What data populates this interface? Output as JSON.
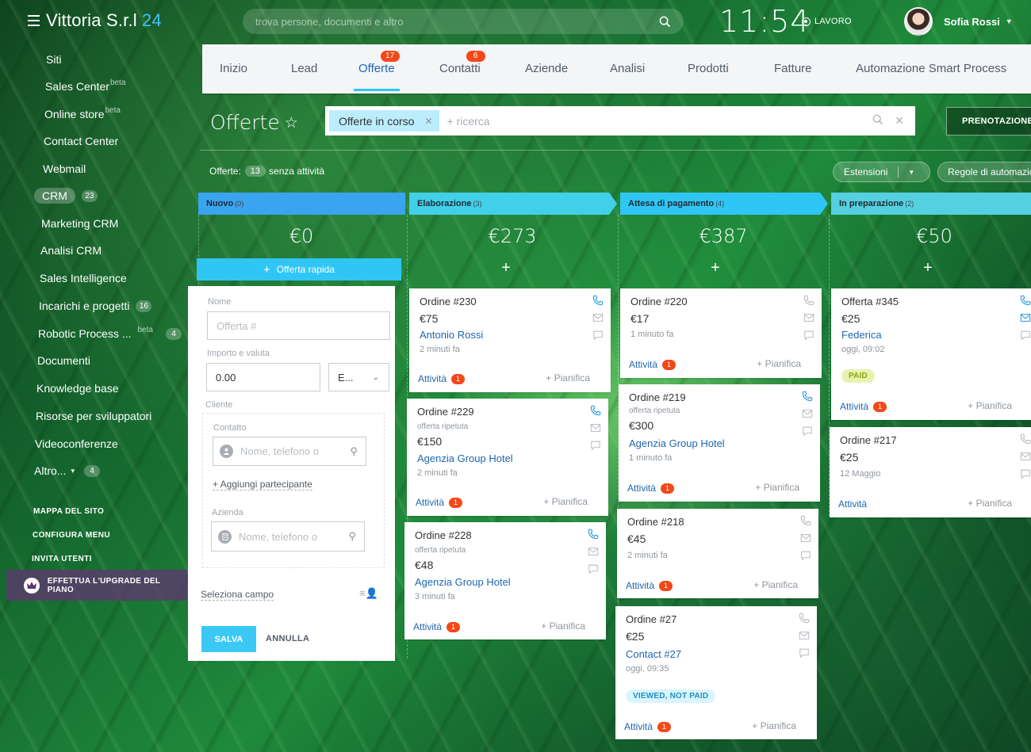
{
  "topbar": {
    "company": "Vittoria S.r.l",
    "company_suffix": "24",
    "search_placeholder": "trova persone, documenti e altro",
    "clock": "11:54",
    "work_status": "LAVORO",
    "user_name": "Sofia Rossi"
  },
  "sidebar": {
    "items": [
      {
        "label": "Siti"
      },
      {
        "label": "Sales Center",
        "sup": "beta"
      },
      {
        "label": "Online store",
        "sup": "beta"
      },
      {
        "label": "Contact Center"
      },
      {
        "label": "Webmail"
      },
      {
        "label": "CRM",
        "count": "23"
      },
      {
        "label": "Marketing CRM"
      },
      {
        "label": "Analisi CRM"
      },
      {
        "label": "Sales Intelligence"
      },
      {
        "label": "Incarichi e progetti",
        "count": "16"
      },
      {
        "label": "Robotic Process ...",
        "sup": "beta",
        "count": "4"
      },
      {
        "label": "Documenti"
      },
      {
        "label": "Knowledge base"
      },
      {
        "label": "Risorse per sviluppatori"
      },
      {
        "label": "Videoconferenze"
      },
      {
        "label": "Altro...",
        "count": "4"
      }
    ],
    "links": [
      "MAPPA DEL SITO",
      "CONFIGURA MENU",
      "INVITA UTENTI"
    ],
    "upgrade": "EFFETTUA L'UPGRADE DEL PIANO"
  },
  "tabs": [
    {
      "label": "Inizio"
    },
    {
      "label": "Lead"
    },
    {
      "label": "Offerte",
      "badge": "17",
      "active": true
    },
    {
      "label": "Contatti",
      "badge": "6"
    },
    {
      "label": "Aziende"
    },
    {
      "label": "Analisi"
    },
    {
      "label": "Prodotti"
    },
    {
      "label": "Fatture"
    },
    {
      "label": "Automazione Smart Process"
    }
  ],
  "page": {
    "title": "Offerte",
    "filter_tag": "Offerte in corso",
    "filter_placeholder": "+ ricerca",
    "booking_button": "PRENOTAZIONE",
    "stats_label": "Offerte:",
    "stats_count": "13",
    "stats_suffix": "senza attività",
    "extensions_button": "Estensioni",
    "rules_button": "Regole di automazione"
  },
  "columns": [
    {
      "name": "Nuovo",
      "count": "(0)",
      "sum": "€0",
      "color": "#3aa4f0"
    },
    {
      "name": "Elaborazione",
      "count": "(3)",
      "sum": "€273",
      "color": "#41d0e8"
    },
    {
      "name": "Attesa di pagamento",
      "count": "(4)",
      "sum": "€387",
      "color": "#2fc6f6"
    },
    {
      "name": "In preparazione",
      "count": "(2)",
      "sum": "€50",
      "color": "#55d0e0"
    }
  ],
  "quick_deal": {
    "button": "Offerta rapida",
    "name_label": "Nome",
    "name_placeholder": "Offerta #",
    "amount_label": "Importo e valuta",
    "amount_value": "0.00",
    "currency": "E...",
    "client_label": "Cliente",
    "contact_label": "Contatto",
    "contact_placeholder": "Nome, telefono o",
    "add_participant": "+ Aggiungi partecipante",
    "company_label": "Azienda",
    "company_placeholder": "Nome, telefono o",
    "select_field": "Seleziona campo",
    "save": "SALVA",
    "cancel": "ANNULLA"
  },
  "cards": {
    "c230": {
      "title": "Ordine #230",
      "price": "€75",
      "link": "Antonio Rossi",
      "time": "2 minuti fa",
      "activity": "Attività",
      "activity_count": "1",
      "plan": "+ Pianifica"
    },
    "c229": {
      "title": "Ordine #229",
      "sub": "offerta ripetuta",
      "price": "€150",
      "link": "Agenzia Group Hotel",
      "time": "2 minuti fa",
      "activity": "Attività",
      "activity_count": "1",
      "plan": "+ Pianifica"
    },
    "c228": {
      "title": "Ordine #228",
      "sub": "offerta ripetuta",
      "price": "€48",
      "link": "Agenzia Group Hotel",
      "time": "3 minuti fa",
      "activity": "Attività",
      "activity_count": "1",
      "plan": "+ Pianifica"
    },
    "c220": {
      "title": "Ordine #220",
      "price": "€17",
      "time": "1 minuto fa",
      "activity": "Attività",
      "activity_count": "1",
      "plan": "+ Pianifica"
    },
    "c219": {
      "title": "Ordine #219",
      "sub": "offerta ripetuta",
      "price": "€300",
      "link": "Agenzia Group Hotel",
      "time": "1 minuto fa",
      "activity": "Attività",
      "activity_count": "1",
      "plan": "+ Pianifica"
    },
    "c218": {
      "title": "Ordine #218",
      "price": "€45",
      "time": "2 minuti fa",
      "activity": "Attività",
      "activity_count": "1",
      "plan": "+ Pianifica"
    },
    "c27": {
      "title": "Ordine #27",
      "price": "€25",
      "link": "Contact #27",
      "time": "oggi, 09:35",
      "badge": "VIEWED, NOT PAID",
      "activity": "Attività",
      "activity_count": "1",
      "plan": "+ Pianifica"
    },
    "c345": {
      "title": "Offerta #345",
      "price": "€25",
      "link": "Federica",
      "time": "oggi, 09:02",
      "badge": "PAID",
      "activity": "Attività",
      "activity_count": "1",
      "plan": "+ Pianifica"
    },
    "c217": {
      "title": "Ordine #217",
      "price": "€25",
      "time": "12 Maggio",
      "activity": "Attività",
      "plan": "+ Pianifica"
    }
  }
}
